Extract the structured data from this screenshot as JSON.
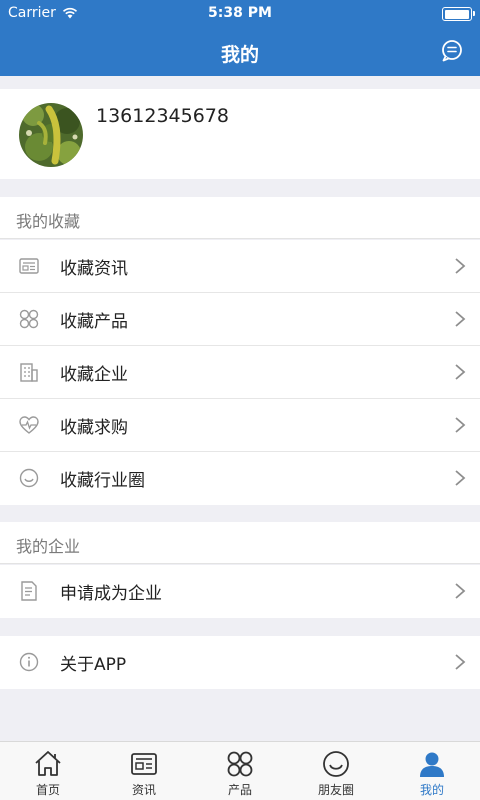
{
  "status_bar": {
    "carrier": "Carrier",
    "time": "5:38 PM",
    "battery_level": 1.0
  },
  "nav": {
    "title": "我的",
    "message_icon": "chat-bubble-icon"
  },
  "profile": {
    "phone": "13612345678",
    "avatar": "avatar-photo"
  },
  "favorites": {
    "header": "我的收藏",
    "items": [
      {
        "label": "收藏资讯",
        "icon": "news-icon"
      },
      {
        "label": "收藏产品",
        "icon": "product-grid-icon"
      },
      {
        "label": "收藏企业",
        "icon": "building-icon"
      },
      {
        "label": "收藏求购",
        "icon": "heartbeat-icon"
      },
      {
        "label": "收藏行业圈",
        "icon": "smile-circle-icon"
      }
    ]
  },
  "company": {
    "header": "我的企业",
    "items": [
      {
        "label": "申请成为企业",
        "icon": "document-icon"
      }
    ]
  },
  "about": {
    "label": "关于APP",
    "icon": "info-icon"
  },
  "tabbar": {
    "active": 4,
    "tabs": [
      {
        "label": "首页",
        "icon": "home-icon"
      },
      {
        "label": "资讯",
        "icon": "news-icon"
      },
      {
        "label": "产品",
        "icon": "product-grid-icon"
      },
      {
        "label": "朋友圈",
        "icon": "smile-circle-icon"
      },
      {
        "label": "我的",
        "icon": "person-icon"
      }
    ]
  },
  "colors": {
    "primary": "#2f79c7",
    "background": "#efeff4",
    "icon_gray": "#9a9a9a"
  }
}
